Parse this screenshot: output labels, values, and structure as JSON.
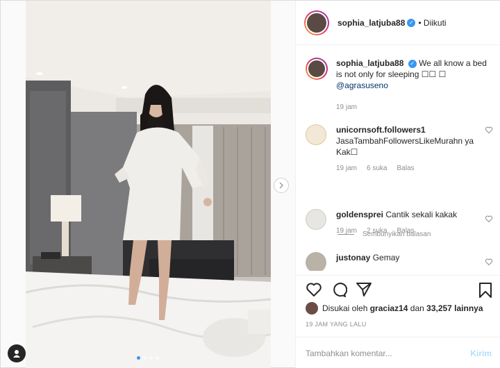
{
  "post_header": {
    "username": "sophia_latjuba88",
    "follow_status": "• Diikuti"
  },
  "caption": {
    "username": "sophia_latjuba88",
    "text": "We all know a bed is not only for sleeping ☐☐ ☐",
    "mention": "@agrasuseno",
    "time": "19 jam"
  },
  "comments": [
    {
      "username": "unicornsoft.followers1",
      "text": "JasaTambahFollowersLikeMurahn ya Kak☐",
      "time": "19 jam",
      "likes": "6 suka",
      "reply": "Balas"
    },
    {
      "username": "goldensprei",
      "text": "Cantik sekali kakak",
      "time": "19 jam",
      "likes": "2 suka",
      "reply": "Balas"
    },
    {
      "username": "justonay",
      "text": "Gemay"
    }
  ],
  "hide_replies": "Sembunyikan balasan",
  "likes": {
    "prefix": "Disukai oleh",
    "user": "graciaz14",
    "middle": "dan",
    "count": "33,257 lainnya"
  },
  "timestamp": "19 JAM YANG LALU",
  "add_comment": {
    "placeholder": "Tambahkan komentar...",
    "send_label": "Kirim"
  },
  "carousel": {
    "total": 4,
    "active": 1
  },
  "icons": {
    "verified": "verified-badge-icon",
    "like": "heart-icon",
    "comment": "comment-icon",
    "share": "paper-plane-icon",
    "save": "bookmark-icon",
    "next": "chevron-right-icon"
  },
  "colors": {
    "link": "#003569",
    "meta": "#8e8e8e",
    "verified": "#3897f0",
    "send_disabled": "#b2dffc"
  }
}
